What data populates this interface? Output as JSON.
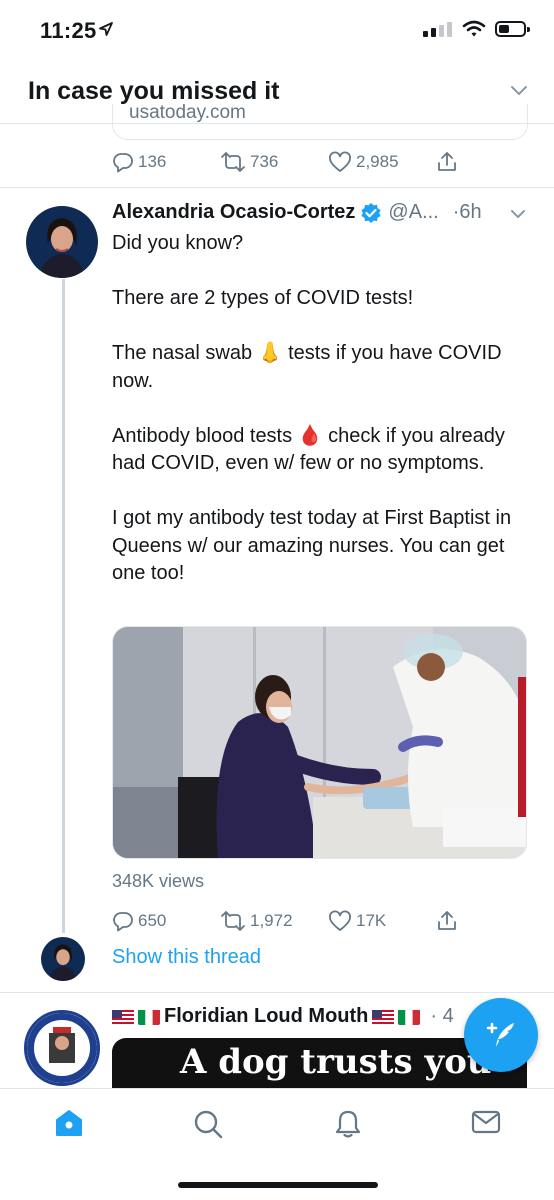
{
  "status_bar": {
    "time": "11:25",
    "battery_level": 0.35
  },
  "header": {
    "title": "In case you missed it"
  },
  "previous_tweet": {
    "link_domain": "usatoday.com",
    "replies": "136",
    "retweets": "736",
    "likes": "2,985"
  },
  "tweet": {
    "author": "Alexandria Ocasio-Cortez",
    "handle": "@A...",
    "separator": "·",
    "time_ago": "6h",
    "text": "Did you know?\n\nThere are 2 types of COVID tests!\n\nThe nasal swab 👃 tests if you have COVID now.\n\nAntibody blood tests 🩸 check if you already had COVID, even w/ few or no symptoms.\n\nI got my antibody test today at First Baptist in Queens w/ our amazing nurses. You can get one too!",
    "views": "348K views",
    "replies": "650",
    "retweets": "1,972",
    "likes": "17K",
    "show_thread": "Show this thread"
  },
  "next_tweet": {
    "author": "Floridian Loud Mouth",
    "time_ago": "· 4",
    "media_text": "A dog trusts you"
  },
  "icons": {
    "reply": "reply-icon",
    "retweet": "retweet-icon",
    "like": "heart-icon",
    "share": "share-icon",
    "verified": "verified-badge-icon",
    "compose": "compose-tweet-icon",
    "tabs": [
      "home-icon",
      "search-icon",
      "notifications-icon",
      "messages-icon"
    ]
  },
  "colors": {
    "accent": "#1da1f2",
    "text": "#14171a",
    "secondary": "#657786",
    "divider": "#e1e8ed"
  }
}
